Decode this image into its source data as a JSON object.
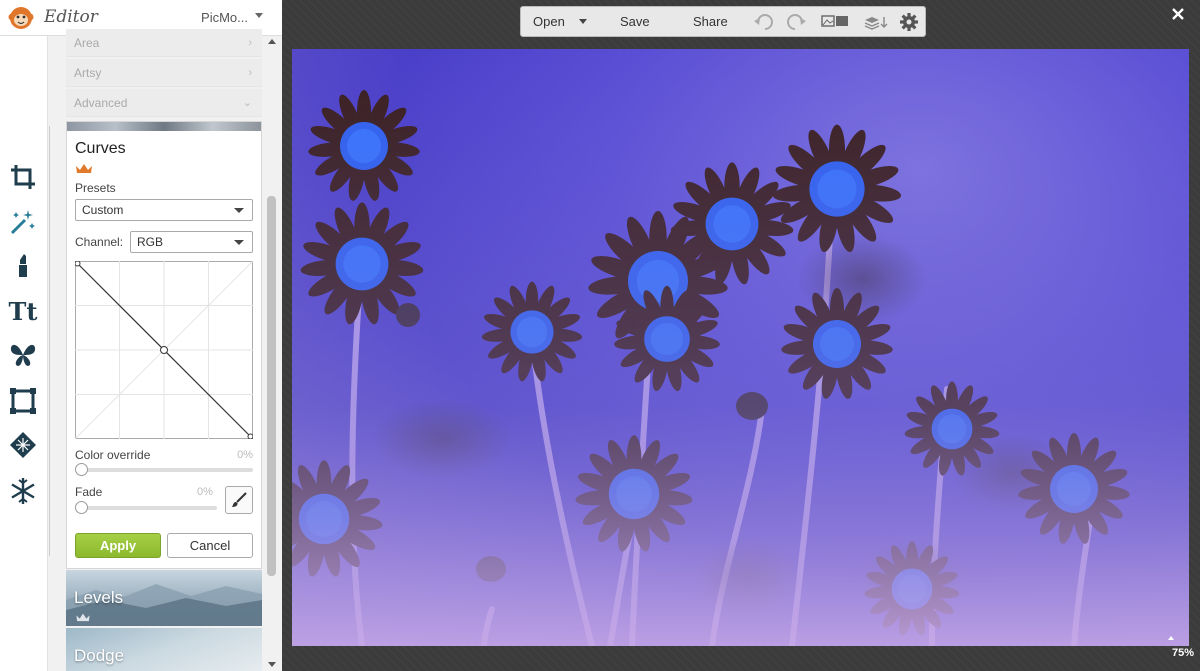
{
  "app": {
    "title": "Editor",
    "account_label": "PicMo...",
    "logo_icon": "monkey-logo-icon"
  },
  "tool_rail": {
    "icons": [
      "crop-icon",
      "magic-wand-icon",
      "lipstick-icon",
      "text-icon",
      "butterfly-icon",
      "frame-icon",
      "texture-icon",
      "snowflake-icon"
    ],
    "text_icon_glyph": "Tt"
  },
  "menu": {
    "items": [
      {
        "label": "Area",
        "arrow": "›"
      },
      {
        "label": "Artsy",
        "arrow": "›"
      },
      {
        "label": "Advanced",
        "arrow": "⌄"
      }
    ]
  },
  "curves": {
    "title": "Curves",
    "presets_label": "Presets",
    "preset_value": "Custom",
    "channel_label": "Channel:",
    "channel_value": "RGB",
    "color_override_label": "Color override",
    "color_override_value": "0%",
    "color_override_level": 0,
    "fade_label": "Fade",
    "fade_value": "0%",
    "fade_level": 0,
    "apply_label": "Apply",
    "cancel_label": "Cancel",
    "premium_icon": "crown-icon",
    "brush_icon": "paintbrush-icon",
    "accent_color": "#8cb92f"
  },
  "effect_tiles": [
    {
      "label": "Levels"
    },
    {
      "label": "Dodge"
    }
  ],
  "toolbar": {
    "open_label": "Open",
    "save_label": "Save",
    "share_label": "Share",
    "icons": [
      "undo-icon",
      "redo-icon",
      "image-compare-icon",
      "layers-icon",
      "settings-icon"
    ]
  },
  "canvas": {
    "zoom_label": "75%",
    "close_icon": "close-icon",
    "photo_subject": "inverted-daisies-photo"
  }
}
